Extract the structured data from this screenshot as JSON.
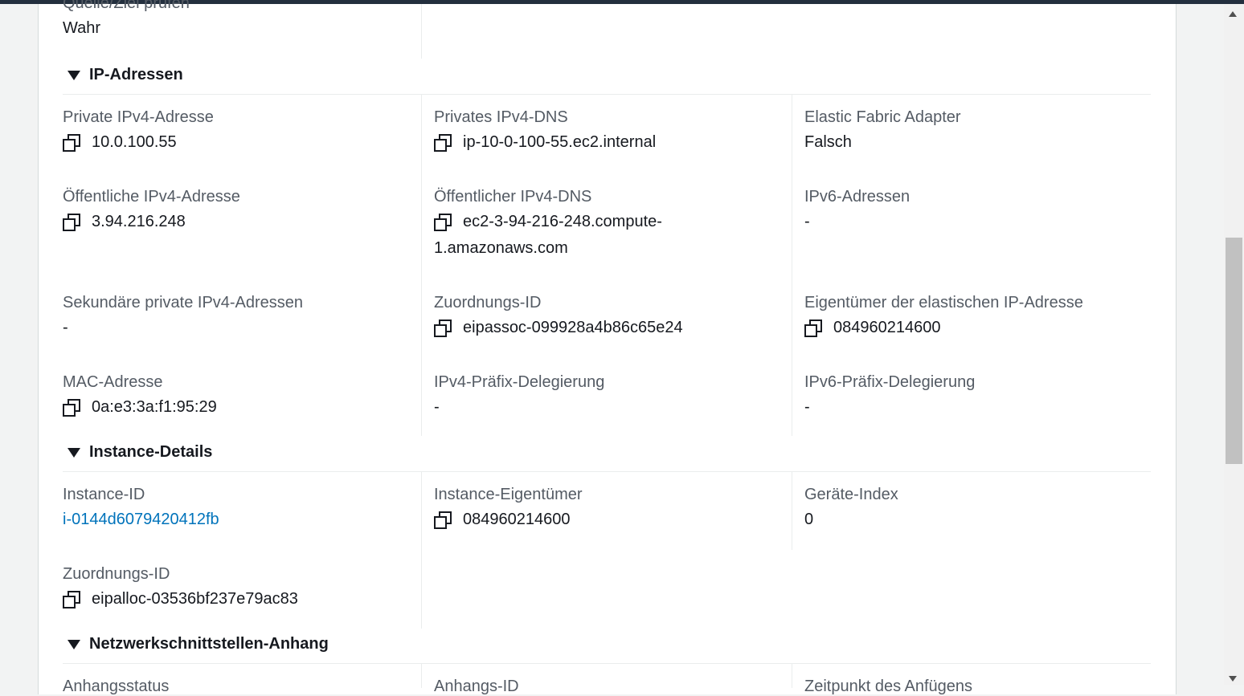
{
  "top_partial": {
    "label": "Quelle/Ziel prüfen",
    "value": "Wahr"
  },
  "sections": {
    "ip": {
      "title": "IP-Adressen",
      "private_ipv4": {
        "label": "Private IPv4-Adresse",
        "value": "10.0.100.55"
      },
      "private_dns": {
        "label": "Privates IPv4-DNS",
        "value": "ip-10-0-100-55.ec2.internal"
      },
      "efa": {
        "label": "Elastic Fabric Adapter",
        "value": "Falsch"
      },
      "public_ipv4": {
        "label": "Öffentliche IPv4-Adresse",
        "value": "3.94.216.248"
      },
      "public_dns": {
        "label": "Öffentlicher IPv4-DNS",
        "value_line1": "ec2-3-94-216-248.compute-",
        "value_line2": "1.amazonaws.com"
      },
      "ipv6": {
        "label": "IPv6-Adressen",
        "value": "-"
      },
      "secondary_private": {
        "label": "Sekundäre private IPv4-Adressen",
        "value": "-"
      },
      "association_id": {
        "label": "Zuordnungs-ID",
        "value": "eipassoc-099928a4b86c65e24"
      },
      "eip_owner": {
        "label": "Eigentümer der elastischen IP-Adresse",
        "value": "084960214600"
      },
      "mac": {
        "label": "MAC-Adresse",
        "value": "0a:e3:3a:f1:95:29"
      },
      "ipv4_prefix": {
        "label": "IPv4-Präfix-Delegierung",
        "value": "-"
      },
      "ipv6_prefix": {
        "label": "IPv6-Präfix-Delegierung",
        "value": "-"
      }
    },
    "instance": {
      "title": "Instance-Details",
      "instance_id": {
        "label": "Instance-ID",
        "value": "i-0144d6079420412fb"
      },
      "owner": {
        "label": "Instance-Eigentümer",
        "value": "084960214600"
      },
      "device_index": {
        "label": "Geräte-Index",
        "value": "0"
      },
      "allocation_id": {
        "label": "Zuordnungs-ID",
        "value": "eipalloc-03536bf237e79ac83"
      }
    },
    "attachment": {
      "title": "Netzwerkschnittstellen-Anhang",
      "status_label": "Anhangsstatus",
      "id_label": "Anhangs-ID",
      "time_label": "Zeitpunkt des Anfügens"
    }
  }
}
